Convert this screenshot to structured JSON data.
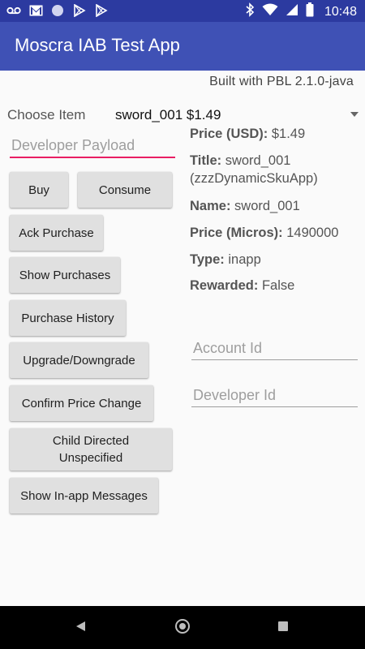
{
  "status_bar": {
    "time": "10:48",
    "icons_left": [
      "voicemail-icon",
      "gmail-icon",
      "circle-icon",
      "play-store-icon",
      "play-store-icon"
    ],
    "icons_right": [
      "bluetooth-icon",
      "wifi-icon",
      "signal-icon",
      "battery-icon"
    ]
  },
  "app_bar": {
    "title": "Moscra IAB Test App"
  },
  "built_with": "Built with PBL 2.1.0-java",
  "choose_item": {
    "label": "Choose Item",
    "selected": "sword_001 $1.49"
  },
  "developer_payload": {
    "placeholder": "Developer Payload",
    "value": ""
  },
  "buttons": {
    "buy": "Buy",
    "consume": "Consume",
    "ack_purchase": "Ack Purchase",
    "show_purchases": "Show Purchases",
    "purchase_history": "Purchase History",
    "upgrade_downgrade": "Upgrade/Downgrade",
    "confirm_price_change": "Confirm Price Change",
    "child_directed_line1": "Child Directed",
    "child_directed_line2": "Unspecified",
    "show_inapp_messages": "Show In-app Messages"
  },
  "sku_info": {
    "price_usd_label": "Price (USD):",
    "price_usd_value": "$1.49",
    "title_label": "Title:",
    "title_value_line1": "sword_001",
    "title_value_line2": "(zzzDynamicSkuApp)",
    "name_label": "Name:",
    "name_value": "sword_001",
    "price_micros_label": "Price (Micros):",
    "price_micros_value": "1490000",
    "type_label": "Type:",
    "type_value": "inapp",
    "rewarded_label": "Rewarded:",
    "rewarded_value": "False"
  },
  "account_id": {
    "placeholder": "Account Id",
    "value": ""
  },
  "developer_id": {
    "placeholder": "Developer Id",
    "value": ""
  },
  "colors": {
    "status_bar": "#2c3aa0",
    "app_bar": "#3f51b5",
    "accent": "#e91e63",
    "button": "#e0e0e0"
  }
}
